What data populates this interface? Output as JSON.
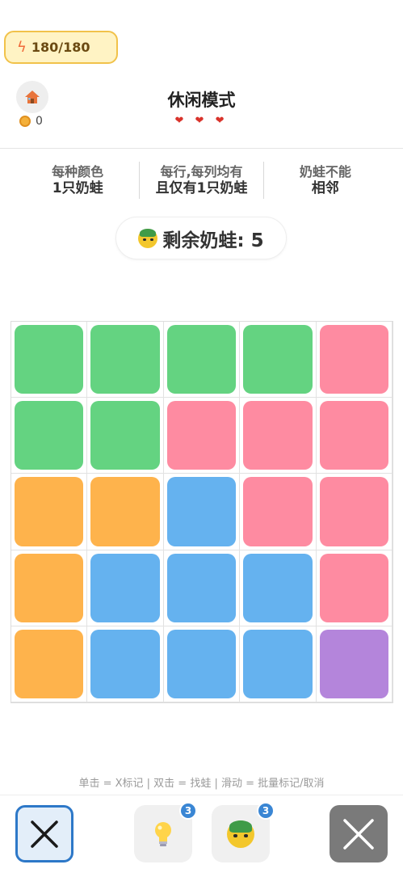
{
  "energy": {
    "icon": "lightning-icon",
    "value": "180/180"
  },
  "header": {
    "home_icon": "home-icon",
    "coin_icon": "coin-icon",
    "coins": "0",
    "title": "休闲模式",
    "lives": 3,
    "hearts": "❤ ❤ ❤"
  },
  "rules": [
    {
      "line1": "每种颜色",
      "line2": "1只奶蛙"
    },
    {
      "line1": "每行,每列均有",
      "line2": "且仅有1只奶蛙"
    },
    {
      "line1": "奶蛙不能",
      "line2": "相邻"
    }
  ],
  "remaining": {
    "icon": "frog-icon",
    "label": "剩余奶蛙: 5"
  },
  "colors": {
    "green": "#64d381",
    "pink": "#fe8ba1",
    "orange": "#feb34c",
    "blue": "#65b2ef",
    "purple": "#b485db",
    "accent_blue": "#2d78c8",
    "badge_blue": "#3a86d4"
  },
  "board": {
    "rows": 5,
    "cols": 5,
    "grid": [
      [
        "green",
        "green",
        "green",
        "green",
        "pink"
      ],
      [
        "green",
        "green",
        "pink",
        "pink",
        "pink"
      ],
      [
        "orange",
        "orange",
        "blue",
        "pink",
        "pink"
      ],
      [
        "orange",
        "blue",
        "blue",
        "blue",
        "pink"
      ],
      [
        "orange",
        "blue",
        "blue",
        "blue",
        "purple"
      ]
    ]
  },
  "hint_text": "单击 = X标记 | 双击 = 找蛙 | 滑动 = 批量标记/取消",
  "toolbar": {
    "mark_x_icon": "x-mark-icon",
    "hint_icon": "lightbulb-icon",
    "hint_count": "3",
    "frog_icon": "frog-icon",
    "frog_count": "3",
    "clear_icon": "x-clear-icon"
  }
}
